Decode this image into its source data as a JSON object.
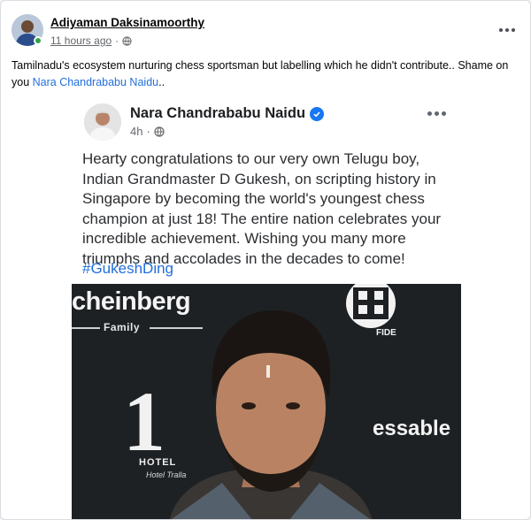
{
  "outer_post": {
    "author": "Adiyaman Daksinamoorthy",
    "time": "11 hours ago",
    "separator": "·",
    "audience_icon": "globe-icon",
    "more_icon": "more-horizontal-icon",
    "text_main": "Tamilnadu's ecosystem nurturing chess sportsman but labelling which he didn't contribute.. Shame on you ",
    "mention": "Nara Chandrababu Naidu",
    "text_tail": ".."
  },
  "shared_screenshot": {
    "author": "Nara Chandrababu Naidu",
    "verified_icon": "verified-badge-icon",
    "time": "4h",
    "separator": "·",
    "audience_icon": "globe-icon",
    "more_icon": "more-horizontal-icon",
    "text": "Hearty congratulations to our very own Telugu boy, Indian Grandmaster D Gukesh, on scripting history in Singapore by becoming the world's youngest chess champion at just 18! The entire nation celebrates your incredible achievement. Wishing you many more triumphs and accolades in the decades to come!",
    "hashtag": "#GukeshDing",
    "photo": {
      "sponsor_1": "cheinberg",
      "sponsor_1_sub": "Family",
      "sponsor_2_mark": "1",
      "sponsor_2_name": "HOTEL",
      "sponsor_2_sub": "Hotel Tralla",
      "sponsor_3": "essable",
      "fide_label": "FIDE"
    }
  },
  "colors": {
    "link_blue": "#216fdb",
    "verified_blue": "#1877f2",
    "online_green": "#31a24c",
    "meta_gray": "#65676b"
  }
}
